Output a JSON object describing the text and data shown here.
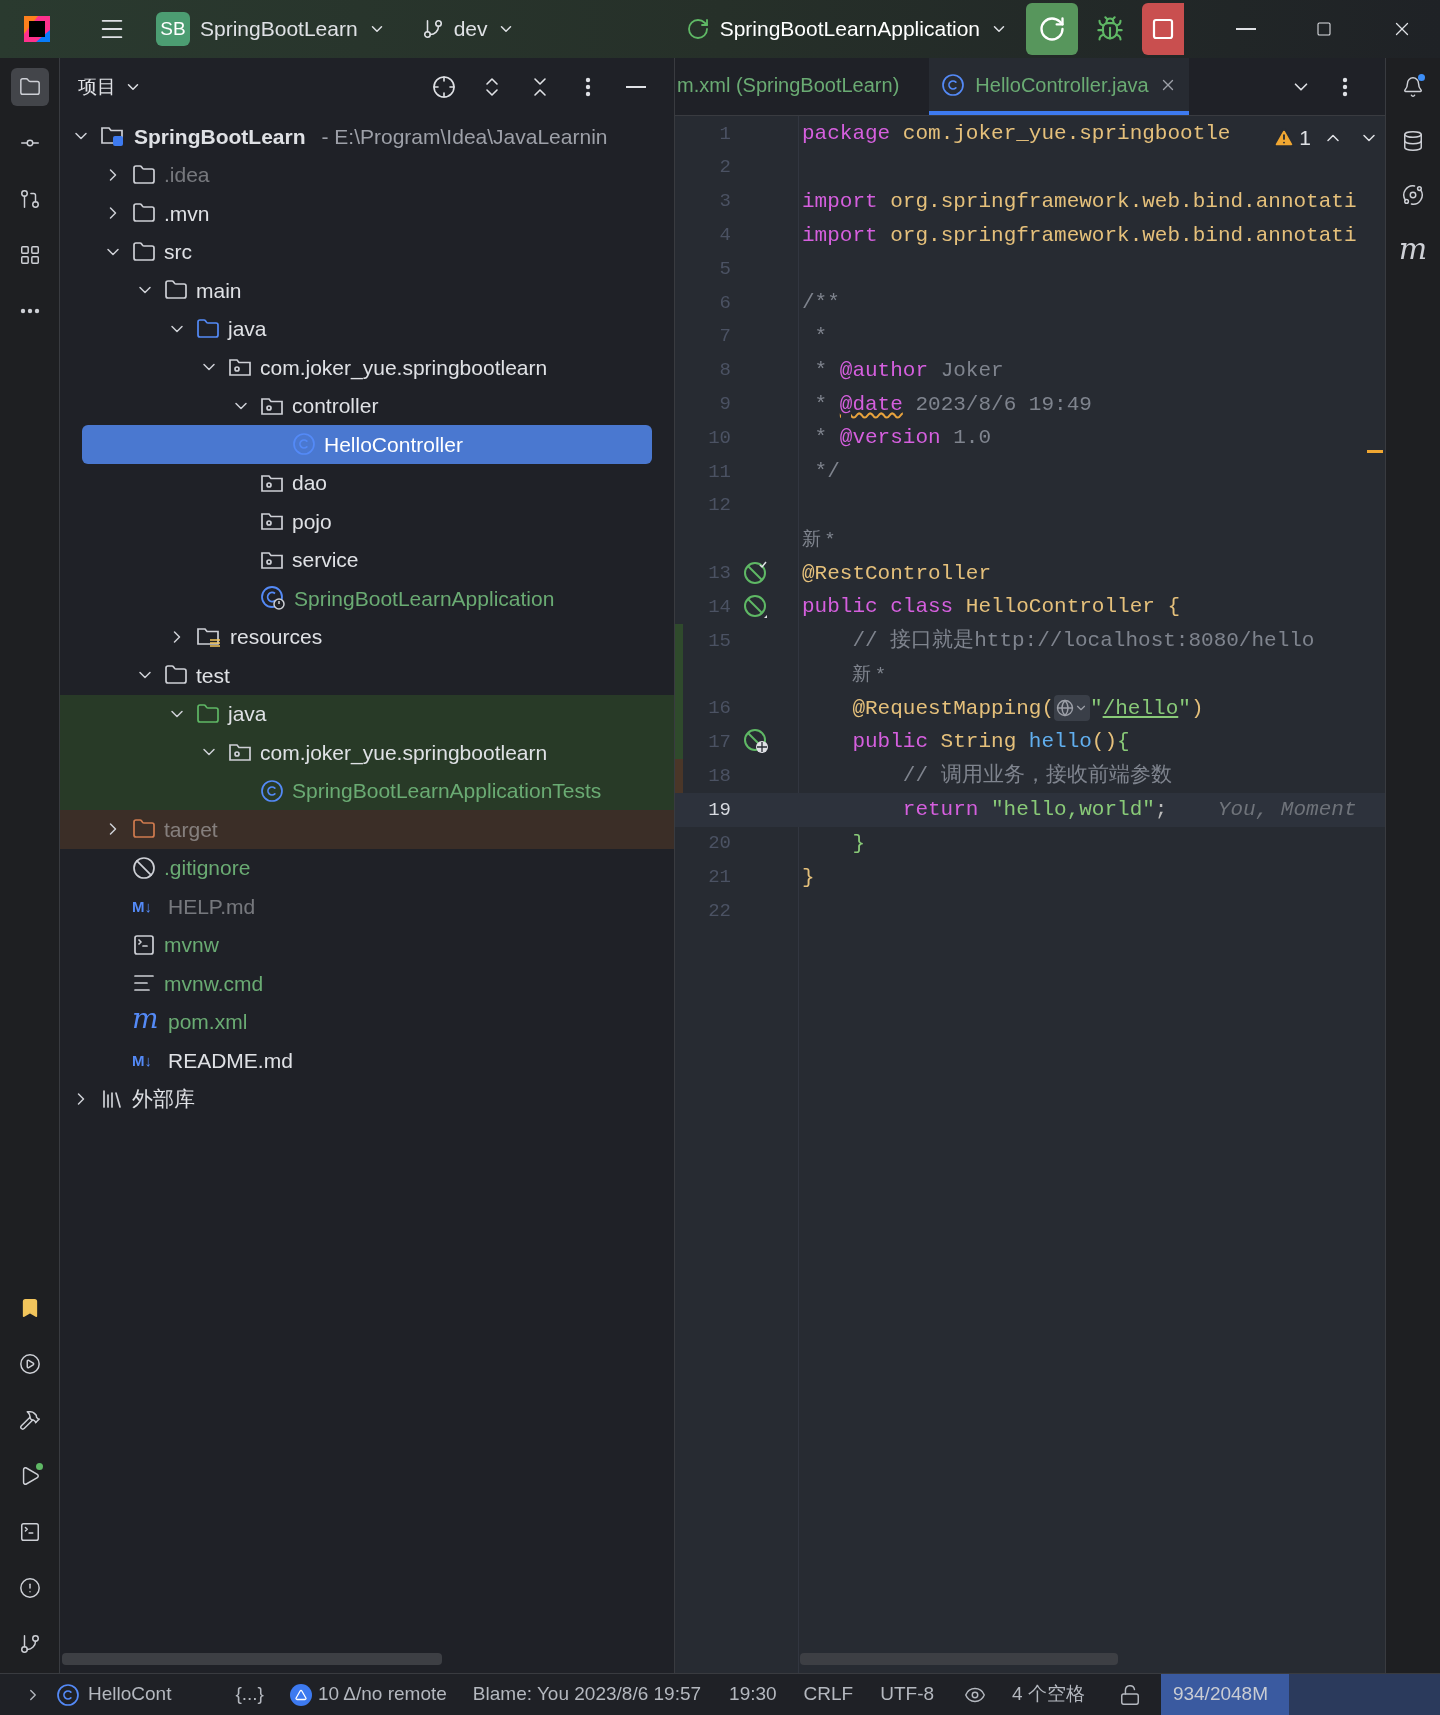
{
  "title_bar": {
    "project_badge": "SB",
    "project": "SpringBootLearn",
    "branch": "dev",
    "run_config": "SpringBootLearnApplication"
  },
  "left_toolbar": {
    "top": [
      {
        "kind": "project",
        "selected": true
      },
      {
        "kind": "commit",
        "selected": false
      },
      {
        "kind": "pull_requests",
        "selected": false
      },
      {
        "kind": "structure",
        "selected": false
      },
      {
        "kind": "more",
        "selected": false
      }
    ],
    "bottom": [
      {
        "kind": "bookmarks",
        "selected": false
      },
      {
        "kind": "services",
        "selected": false
      },
      {
        "kind": "build",
        "selected": false
      },
      {
        "kind": "run",
        "selected": false
      },
      {
        "kind": "terminal",
        "selected": false
      },
      {
        "kind": "problems",
        "selected": false
      },
      {
        "kind": "git",
        "selected": false
      }
    ]
  },
  "right_toolbar": [
    {
      "kind": "notifications"
    },
    {
      "kind": "database"
    },
    {
      "kind": "ai"
    },
    {
      "kind": "maven",
      "label": "m"
    }
  ],
  "project_panel": {
    "title": "项目",
    "tree": [
      {
        "kind": "project",
        "label": "SpringBootLearn",
        "path": "- E:\\Program\\Idea\\JavaLearnin",
        "added": false,
        "ignored": false,
        "test_source": false,
        "excluded": false,
        "expanded": true,
        "selected": false,
        "children": [
          {
            "kind": "folder",
            "label": ".idea",
            "added": false,
            "ignored": true,
            "test_source": false,
            "excluded": false,
            "expanded": false,
            "selected": false
          },
          {
            "kind": "folder",
            "label": ".mvn",
            "added": false,
            "ignored": false,
            "test_source": false,
            "excluded": false,
            "expanded": false,
            "selected": false
          },
          {
            "kind": "folder",
            "label": "src",
            "added": false,
            "ignored": false,
            "test_source": false,
            "excluded": false,
            "expanded": true,
            "selected": false,
            "children": [
              {
                "kind": "folder",
                "label": "main",
                "added": false,
                "ignored": false,
                "test_source": false,
                "excluded": false,
                "expanded": true,
                "selected": false,
                "children": [
                  {
                    "kind": "source_folder",
                    "label": "java",
                    "added": false,
                    "ignored": false,
                    "test_source": false,
                    "excluded": false,
                    "expanded": true,
                    "selected": false,
                    "children": [
                      {
                        "kind": "package",
                        "label": "com.joker_yue.springbootlearn",
                        "added": false,
                        "ignored": false,
                        "test_source": false,
                        "excluded": false,
                        "expanded": true,
                        "selected": false,
                        "children": [
                          {
                            "kind": "package",
                            "label": "controller",
                            "added": false,
                            "ignored": false,
                            "test_source": false,
                            "excluded": false,
                            "expanded": true,
                            "selected": false,
                            "children": [
                              {
                                "kind": "class",
                                "label": "HelloController",
                                "added": false,
                                "ignored": false,
                                "test_source": false,
                                "excluded": false,
                                "selected": true
                              }
                            ]
                          },
                          {
                            "kind": "package",
                            "label": "dao",
                            "added": false,
                            "ignored": false,
                            "test_source": false,
                            "excluded": false,
                            "selected": false
                          },
                          {
                            "kind": "package",
                            "label": "pojo",
                            "added": false,
                            "ignored": false,
                            "test_source": false,
                            "excluded": false,
                            "selected": false
                          },
                          {
                            "kind": "package",
                            "label": "service",
                            "added": false,
                            "ignored": false,
                            "test_source": false,
                            "excluded": false,
                            "selected": false
                          },
                          {
                            "kind": "app_class",
                            "label": "SpringBootLearnApplication",
                            "added": true,
                            "ignored": false,
                            "test_source": false,
                            "excluded": false,
                            "selected": false
                          }
                        ]
                      }
                    ]
                  },
                  {
                    "kind": "resources",
                    "label": "resources",
                    "added": false,
                    "ignored": false,
                    "test_source": false,
                    "excluded": false,
                    "expanded": false,
                    "selected": false
                  }
                ]
              },
              {
                "kind": "folder",
                "label": "test",
                "added": false,
                "ignored": false,
                "test_source": false,
                "excluded": false,
                "expanded": true,
                "selected": false,
                "children": [
                  {
                    "kind": "test_folder",
                    "label": "java",
                    "added": false,
                    "ignored": false,
                    "test_source": true,
                    "excluded": false,
                    "expanded": true,
                    "selected": false,
                    "children": [
                      {
                        "kind": "package",
                        "label": "com.joker_yue.springbootlearn",
                        "added": false,
                        "ignored": false,
                        "test_source": true,
                        "excluded": false,
                        "expanded": true,
                        "selected": false,
                        "children": [
                          {
                            "kind": "class",
                            "label": "SpringBootLearnApplicationTests",
                            "added": true,
                            "ignored": false,
                            "test_source": true,
                            "excluded": false,
                            "selected": false
                          }
                        ]
                      }
                    ]
                  }
                ]
              }
            ]
          },
          {
            "kind": "excluded_folder",
            "label": "target",
            "added": false,
            "ignored": true,
            "test_source": false,
            "excluded": true,
            "expanded": false,
            "selected": false
          },
          {
            "kind": "ignore_file",
            "label": ".gitignore",
            "added": true,
            "ignored": false,
            "test_source": false,
            "excluded": false,
            "selected": false
          },
          {
            "kind": "markdown",
            "icon_text": "M↓",
            "label": "HELP.md",
            "added": false,
            "ignored": true,
            "test_source": false,
            "excluded": false,
            "selected": false
          },
          {
            "kind": "shell",
            "label": "mvnw",
            "added": true,
            "ignored": false,
            "test_source": false,
            "excluded": false,
            "selected": false
          },
          {
            "kind": "text",
            "label": "mvnw.cmd",
            "added": true,
            "ignored": false,
            "test_source": false,
            "excluded": false,
            "selected": false
          },
          {
            "kind": "maven",
            "icon_text": "m",
            "label": "pom.xml",
            "added": true,
            "ignored": false,
            "test_source": false,
            "excluded": false,
            "selected": false
          },
          {
            "kind": "markdown",
            "icon_text": "M↓",
            "label": "README.md",
            "added": false,
            "ignored": false,
            "test_source": false,
            "excluded": false,
            "selected": false
          }
        ]
      },
      {
        "kind": "library",
        "label": "外部库",
        "added": false,
        "ignored": false,
        "test_source": false,
        "excluded": false,
        "expanded": false,
        "selected": false
      }
    ]
  },
  "tabs": [
    {
      "label": "m.xml (SpringBootLearn)",
      "added": true,
      "selected": false,
      "closable": false
    },
    {
      "label": "HelloController.java",
      "added": true,
      "selected": true,
      "closable": true
    }
  ],
  "editor": {
    "problems": "1",
    "lines": [
      {
        "number": "1",
        "current": false,
        "vcs_added": false,
        "vcs_modified": false,
        "tokens": [
          {
            "kind": "keyword",
            "text": "package"
          },
          {
            "kind": "ident",
            "text": " com.joker_yue.springbootle"
          }
        ]
      },
      {
        "number": "2",
        "current": false,
        "vcs_added": false,
        "vcs_modified": false
      },
      {
        "number": "3",
        "current": false,
        "vcs_added": false,
        "vcs_modified": false,
        "tokens": [
          {
            "kind": "keyword",
            "text": "import"
          },
          {
            "kind": "ident",
            "text": " org.springframework.web.bind.annotati"
          }
        ]
      },
      {
        "number": "4",
        "current": false,
        "vcs_added": false,
        "vcs_modified": false,
        "tokens": [
          {
            "kind": "keyword",
            "text": "import"
          },
          {
            "kind": "ident",
            "text": " org.springframework.web.bind.annotati"
          }
        ]
      },
      {
        "number": "5",
        "current": false,
        "vcs_added": false,
        "vcs_modified": false
      },
      {
        "number": "6",
        "current": false,
        "vcs_added": false,
        "vcs_modified": false,
        "tokens": [
          {
            "kind": "comment",
            "text": "/**"
          }
        ]
      },
      {
        "number": "7",
        "current": false,
        "vcs_added": false,
        "vcs_modified": false,
        "tokens": [
          {
            "kind": "comment",
            "text": " *"
          }
        ]
      },
      {
        "number": "8",
        "current": false,
        "vcs_added": false,
        "vcs_modified": false,
        "tokens": [
          {
            "kind": "comment",
            "text": " * "
          },
          {
            "kind": "doctag",
            "text": "@author"
          },
          {
            "kind": "comment",
            "text": " Joker"
          }
        ]
      },
      {
        "number": "9",
        "current": false,
        "vcs_added": false,
        "vcs_modified": false,
        "tokens": [
          {
            "kind": "comment",
            "text": " * "
          },
          {
            "kind": "doctag_warning",
            "text": "@date"
          },
          {
            "kind": "comment",
            "text": " 2023/8/6 19:49"
          }
        ]
      },
      {
        "number": "10",
        "current": false,
        "vcs_added": false,
        "vcs_modified": false,
        "tokens": [
          {
            "kind": "comment",
            "text": " * "
          },
          {
            "kind": "doctag",
            "text": "@version"
          },
          {
            "kind": "comment",
            "text": " 1.0"
          }
        ]
      },
      {
        "number": "11",
        "current": false,
        "vcs_added": false,
        "vcs_modified": false,
        "tokens": [
          {
            "kind": "comment",
            "text": " */"
          }
        ]
      },
      {
        "number": "12",
        "current": false,
        "vcs_added": false,
        "vcs_modified": false
      },
      {
        "vcs_added": false,
        "vcs_modified": false,
        "tokens": [
          {
            "kind": "inlay",
            "text": "新 *"
          }
        ]
      },
      {
        "number": "13",
        "gutter": {
          "kind": "bean_check"
        },
        "current": false,
        "vcs_added": false,
        "vcs_modified": false,
        "tokens": [
          {
            "kind": "ident",
            "text": "@RestController"
          }
        ]
      },
      {
        "number": "14",
        "gutter": {
          "kind": "bean"
        },
        "current": false,
        "vcs_added": false,
        "vcs_modified": false,
        "tokens": [
          {
            "kind": "keyword",
            "text": "public class"
          },
          {
            "kind": "ident",
            "text": " HelloController "
          },
          {
            "kind": "bracket",
            "text": "{"
          }
        ]
      },
      {
        "number": "15",
        "current": false,
        "vcs_added": true,
        "vcs_modified": false,
        "tokens": [
          {
            "kind": "comment",
            "text": "    // 接口就是http://localhost:8080/hello"
          }
        ]
      },
      {
        "vcs_added": true,
        "vcs_modified": false,
        "tokens": [
          {
            "kind": "inlay",
            "text": "    新 *"
          }
        ]
      },
      {
        "number": "16",
        "current": false,
        "vcs_added": true,
        "vcs_modified": false,
        "tokens": [
          {
            "kind": "ident",
            "text": "    @RequestMapping"
          },
          {
            "kind": "bracket",
            "text": "("
          },
          {
            "kind": "globe"
          },
          {
            "kind": "string",
            "text": "\""
          },
          {
            "kind": "url",
            "text": "/hello"
          },
          {
            "kind": "string",
            "text": "\""
          },
          {
            "kind": "bracket",
            "text": ")"
          }
        ]
      },
      {
        "number": "17",
        "gutter": {
          "kind": "endpoint"
        },
        "current": false,
        "vcs_added": true,
        "vcs_modified": false,
        "tokens": [
          {
            "kind": "keyword",
            "text": "    public"
          },
          {
            "kind": "ident",
            "text": " String "
          },
          {
            "kind": "method",
            "text": "hello"
          },
          {
            "kind": "bracket",
            "text": "()"
          },
          {
            "kind": "bracket_inner",
            "text": "{"
          }
        ]
      },
      {
        "number": "18",
        "current": false,
        "vcs_added": false,
        "vcs_modified": true,
        "tokens": [
          {
            "kind": "comment",
            "text": "        // 调用业务，接收前端参数"
          }
        ]
      },
      {
        "number": "19",
        "current": true,
        "vcs_added": false,
        "vcs_modified": false,
        "tokens": [
          {
            "kind": "keyword",
            "text": "        return "
          },
          {
            "kind": "string",
            "text": "\"hello,world\""
          },
          {
            "kind": "punct",
            "text": ";"
          },
          {
            "kind": "blame",
            "text": "    You, Moment"
          }
        ]
      },
      {
        "number": "20",
        "current": false,
        "vcs_added": false,
        "vcs_modified": false,
        "tokens": [
          {
            "kind": "bracket_inner",
            "text": "    }"
          }
        ]
      },
      {
        "number": "21",
        "current": false,
        "vcs_added": false,
        "vcs_modified": false,
        "tokens": [
          {
            "kind": "bracket",
            "text": "}"
          }
        ]
      },
      {
        "number": "22",
        "current": false,
        "vcs_added": false,
        "vcs_modified": false
      }
    ]
  },
  "status_bar": {
    "breadcrumb": "HelloCont",
    "code_context": "{...}",
    "vcs": "10 Δ/no remote",
    "blame": "Blame: You 2023/8/6 19:57",
    "position": "19:30",
    "line_separator": "CRLF",
    "encoding": "UTF-8",
    "indent": "4 个空格",
    "memory": {
      "text": "934/2048M",
      "level": 0.46
    }
  }
}
